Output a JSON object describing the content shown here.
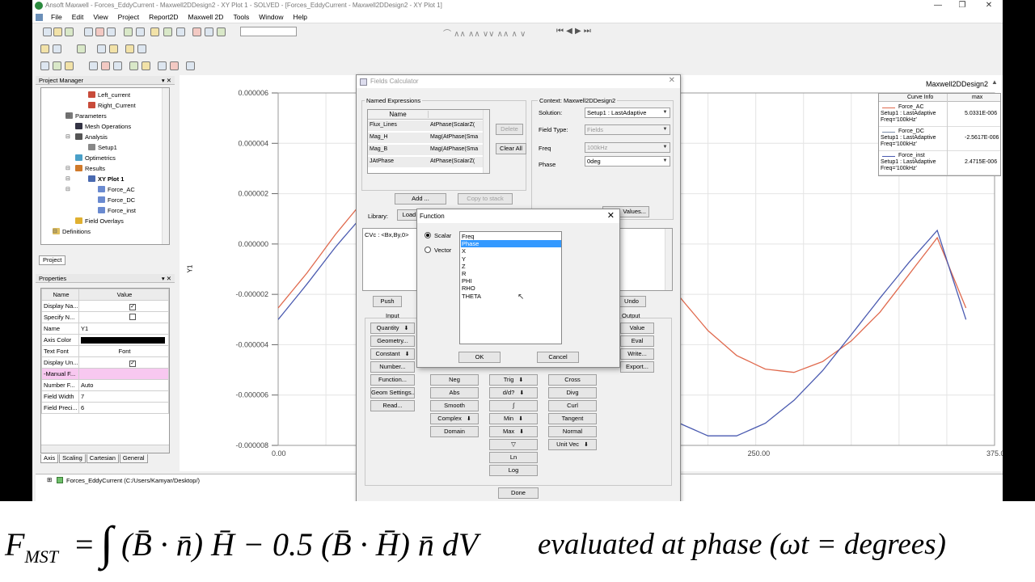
{
  "window": {
    "title": "Ansoft Maxwell - Forces_EddyCurrent - Maxwell2DDesign2 - XY Plot 1 - SOLVED - [Forces_EddyCurrent - Maxwell2DDesign2 - XY Plot 1]",
    "menu": [
      "File",
      "Edit",
      "View",
      "Project",
      "Report2D",
      "Maxwell 2D",
      "Tools",
      "Window",
      "Help"
    ]
  },
  "project_manager": {
    "title": "Project Manager",
    "items": [
      {
        "label": "Left_current",
        "icon": "coil-icon"
      },
      {
        "label": "Right_Current",
        "icon": "coil-icon"
      },
      {
        "label": "Parameters",
        "icon": "parameters-icon"
      },
      {
        "label": "Mesh Operations",
        "icon": "mesh-icon"
      },
      {
        "label": "Analysis",
        "icon": "analysis-icon"
      },
      {
        "label": "Setup1",
        "icon": "setup-icon"
      },
      {
        "label": "Optimetrics",
        "icon": "optimetrics-icon"
      },
      {
        "label": "Results",
        "icon": "results-icon"
      },
      {
        "label": "XY Plot 1",
        "icon": "plot-icon"
      },
      {
        "label": "Force_AC",
        "icon": "trace-icon"
      },
      {
        "label": "Force_DC",
        "icon": "trace-icon"
      },
      {
        "label": "Force_inst",
        "icon": "trace-icon"
      },
      {
        "label": "Field Overlays",
        "icon": "field-overlay-icon"
      },
      {
        "label": "Definitions",
        "icon": "folder-icon"
      }
    ],
    "tab": "Project"
  },
  "properties": {
    "title": "Properties",
    "col_name": "Name",
    "col_value": "Value",
    "rows": [
      {
        "name": "Display Na...",
        "value": ""
      },
      {
        "name": "Specify N...",
        "value": ""
      },
      {
        "name": "Name",
        "value": "Y1"
      },
      {
        "name": "Axis Color",
        "value": ""
      },
      {
        "name": "Text Font",
        "value": "Font"
      },
      {
        "name": "Display Un...",
        "value": ""
      },
      {
        "name": "-Manual F...",
        "value": ""
      },
      {
        "name": "Number F...",
        "value": "Auto"
      },
      {
        "name": "Field Width",
        "value": "7"
      },
      {
        "name": "Field Preci...",
        "value": "6"
      }
    ],
    "tabs": [
      "Axis",
      "Scaling",
      "Cartesian",
      "General"
    ]
  },
  "status": {
    "project_path": "Forces_EddyCurrent (C:/Users/Kamyar/Desktop/)"
  },
  "plot": {
    "design_name": "Maxwell2DDesign2",
    "y_axis_label": "Y1",
    "legend_header": [
      "Curve Info",
      "max"
    ],
    "legend": [
      {
        "name": "Force_AC",
        "setup": "Setup1 : LastAdaptive",
        "freq": "Freq='100kHz'",
        "max": "5.0331E-006",
        "color": "#e06a4e"
      },
      {
        "name": "Force_DC",
        "setup": "Setup1 : LastAdaptive",
        "freq": "Freq='100kHz'",
        "max": "-2.5617E-006",
        "color": "#7a8ca8"
      },
      {
        "name": "Force_inst",
        "setup": "Setup1 : LastAdaptive",
        "freq": "Freq='100kHz'",
        "max": "2.4715E-006",
        "color": "#4a5ab0"
      }
    ]
  },
  "chart_data": {
    "type": "line",
    "xlabel": "",
    "ylabel": "Y1",
    "xlim": [
      0,
      375
    ],
    "ylim": [
      -8e-06,
      6e-06
    ],
    "x_ticks": [
      "0.00",
      "250.00",
      "375.00"
    ],
    "y_ticks": [
      "0.000006",
      "0.000004",
      "0.000002",
      "0.000000",
      "-0.000002",
      "-0.000004",
      "-0.000006",
      "-0.000008"
    ],
    "grid": true,
    "legend_position": "top-right",
    "series": [
      {
        "name": "Force_AC",
        "color": "#e06a4e",
        "x": [
          0,
          15,
          30,
          45,
          60,
          75,
          90,
          105,
          120,
          135,
          150,
          165,
          180,
          195,
          210,
          225,
          240,
          255,
          270,
          285,
          300,
          315,
          330,
          345,
          360
        ],
        "y": [
          -2.54e-06,
          -1.16e-06,
          3.8e-07,
          1.76e-06,
          3.02e-06,
          4.06e-06,
          4.7e-06,
          5.03e-06,
          4.93e-06,
          4.41e-06,
          3.53e-06,
          2.37e-06,
          8.5e-07,
          -6.2e-07,
          -2.09e-06,
          -3.44e-06,
          -4.43e-06,
          -4.97e-06,
          -5.1e-06,
          -4.67e-06,
          -3.85e-06,
          -2.71e-06,
          -1.23e-06,
          2.5e-07,
          -2.54e-06
        ]
      },
      {
        "name": "Force_inst",
        "color": "#4a5ab0",
        "x": [
          0,
          15,
          30,
          45,
          60,
          75,
          90,
          105,
          120,
          135,
          150,
          165,
          180,
          195,
          210,
          225,
          240,
          255,
          270,
          285,
          300,
          315,
          330,
          345,
          360
        ],
        "y": [
          -3e-06,
          -1.6e-06,
          -1.2e-07,
          1.2e-06,
          2.12e-06,
          2.47e-06,
          2.26e-06,
          1.61e-06,
          5.4e-07,
          -7.5e-07,
          -2.15e-06,
          -3.6e-06,
          -5.03e-06,
          -6.21e-06,
          -7.12e-06,
          -7.62e-06,
          -7.62e-06,
          -7.12e-06,
          -6.21e-06,
          -5.03e-06,
          -3.6e-06,
          -2.15e-06,
          -7.5e-07,
          5.4e-07,
          -3e-06
        ]
      }
    ]
  },
  "fields_calculator": {
    "title": "Fields Calculator",
    "named_expressions": {
      "group": "Named Expressions",
      "header": "Name",
      "rows": [
        {
          "name": "Flux_Lines",
          "expr": "AtPhase(ScalarZ("
        },
        {
          "name": "Mag_H",
          "expr": "Mag(AtPhase(Sma"
        },
        {
          "name": "Mag_B",
          "expr": "Mag(AtPhase(Sma"
        },
        {
          "name": "JAtPhase",
          "expr": "AtPhase(ScalarZ("
        }
      ],
      "delete": "Delete",
      "clear_all": "Clear All",
      "add": "Add ...",
      "copy_to_stack": "Copy to stack"
    },
    "context": {
      "title": "Context: Maxwell2DDesign2",
      "solution_label": "Solution:",
      "solution": "Setup1 : LastAdaptive",
      "field_type_label": "Field Type:",
      "field_type": "Fields",
      "freq_label": "Freq",
      "freq": "100kHz",
      "phase_label": "Phase",
      "phase": "0deg",
      "values_button": "Values..."
    },
    "library_label": "Library:",
    "load_button": "Load",
    "stack_text": "CVc : <Bx,By,0>",
    "push": "Push",
    "undo": "Undo",
    "input_label": "Input",
    "output_label": "Output",
    "input_buttons": [
      "Quantity",
      "Geometry...",
      "Constant",
      "Number...",
      "Function...",
      "Geom Settings...",
      "Read..."
    ],
    "scalar_buttons": [
      "Neg",
      "Abs",
      "Smooth",
      "Complex",
      "Domain"
    ],
    "math_buttons": [
      "Trig",
      "d/d?",
      "∫",
      "Min",
      "Max",
      "▽",
      "Ln",
      "Log"
    ],
    "vector_buttons": [
      "Cross",
      "Divg",
      "Curl",
      "Tangent",
      "Normal",
      "Unit Vec"
    ],
    "output_buttons": [
      "Value",
      "Eval",
      "Write...",
      "Export..."
    ],
    "done": "Done"
  },
  "function_dialog": {
    "title": "Function",
    "scalar_label": "Scalar",
    "vector_label": "Vector",
    "items": [
      "Freq",
      "Phase",
      "X",
      "Y",
      "Z",
      "R",
      "PHI",
      "RHO",
      "THETA"
    ],
    "selected_index": 1,
    "ok": "OK",
    "cancel": "Cancel"
  },
  "formula": {
    "lhs": "F",
    "lhs_sub": "MST",
    "equals": "=",
    "integral": "∫",
    "body1": "(B̄ · n̄) H̄ − 0.5 (B̄ · H̄) n̄ dV",
    "caption": "evaluated at phase (ωt = degrees)"
  }
}
